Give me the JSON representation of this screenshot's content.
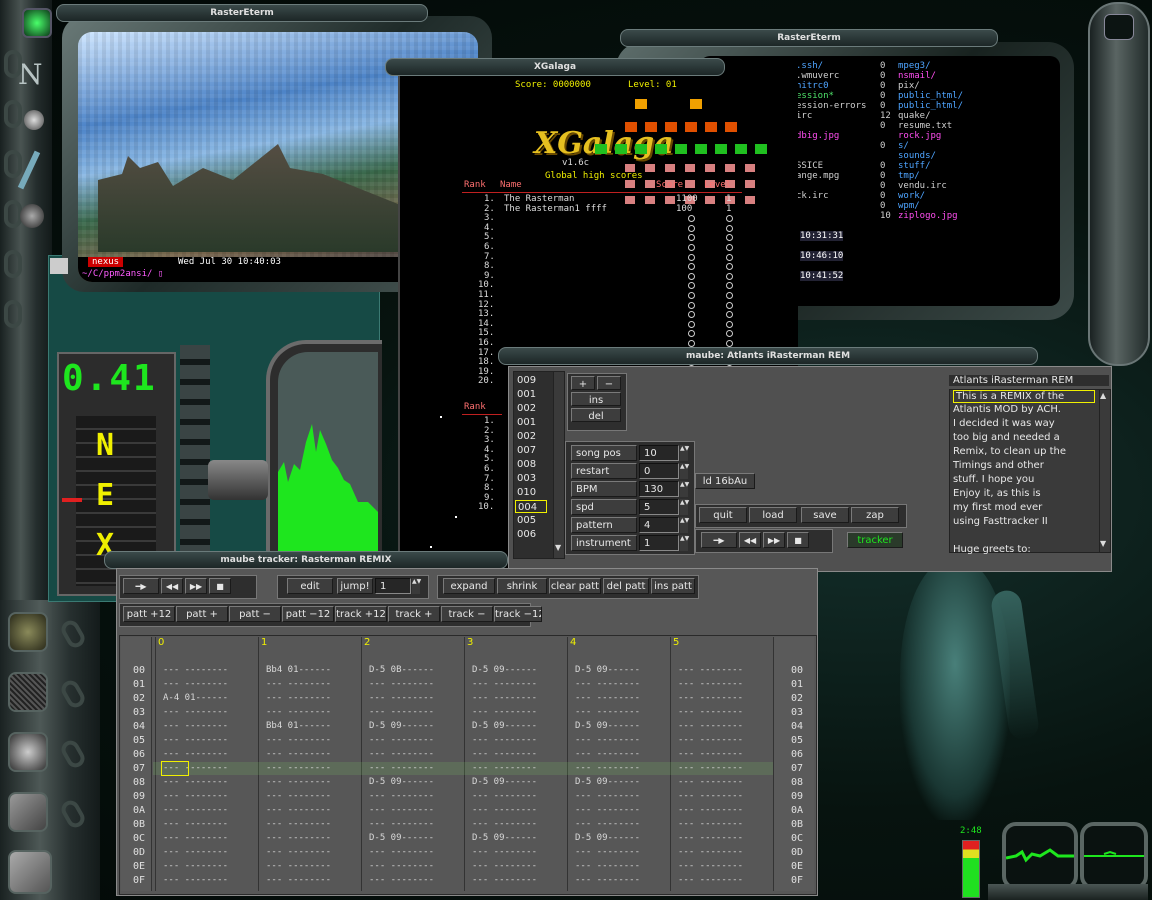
{
  "desktop": {
    "dock_letter": "N"
  },
  "term1": {
    "title": "RasterEterm",
    "status_name": "nexus",
    "status_date": "Wed Jul 30  10:40:03",
    "prompt": "~/C/ppm2ansi/ ▯"
  },
  "term2": {
    "title": "RasterEterm",
    "col1": [
      ".ssh/",
      ".wmuverc",
      "hitrc0",
      "ession*",
      "ession-errors",
      "irc",
      "",
      "dbig.jpg",
      "",
      "",
      "SSICE",
      "ange.mpg",
      "",
      "ck.irc"
    ],
    "col1_colors": [
      "#4ea4ff",
      "#d0d0d0",
      "#4ea4ff",
      "#4ee06a",
      "#d0d0d0",
      "#d0d0d0",
      "#d0d0d0",
      "#ff4ef0",
      "#d0d0d0",
      "#d0d0d0",
      "#d0d0d0",
      "#d0d0d0",
      "#d0d0d0",
      "#d0d0d0"
    ],
    "col2_nums": [
      "0",
      "0",
      "0",
      "0",
      "0",
      "12",
      "0",
      "",
      "0",
      "",
      "0",
      "0",
      "0",
      "0",
      "0",
      "10"
    ],
    "col2": [
      "mpeg3/",
      "nsmail/",
      "pix/",
      "public_html/",
      "public_html/",
      "quake/",
      "resume.txt",
      "rock.jpg",
      "s/",
      "sounds/",
      "stuff/",
      "tmp/",
      "vendu.irc",
      "work/",
      "wpm/",
      "ziplogo.jpg"
    ],
    "col2_colors": [
      "#4ea4ff",
      "#ff4ef0",
      "#d0d0d0",
      "#4ea4ff",
      "#4ea4ff",
      "#d0d0d0",
      "#d0d0d0",
      "#ff4ef0",
      "#4ea4ff",
      "#4ea4ff",
      "#4ea4ff",
      "#4ea4ff",
      "#d0d0d0",
      "#4ea4ff",
      "#4ea4ff",
      "#ff4ef0"
    ],
    "times": [
      "10:31:31",
      "10:46:10",
      "10:41:52"
    ]
  },
  "xgalaga": {
    "title": "XGalaga",
    "score_label": "Score: 0000000",
    "level_label": "Level: 01",
    "logo": "XGalaga",
    "version": "v1.6c",
    "global_label": "Global high scores",
    "rank_label": "Rank",
    "name_label": "Name",
    "score_col_label": "Score",
    "level_col_label": "Level",
    "entries": [
      {
        "rank": "1.",
        "name": "The Rasterman",
        "score": "1100",
        "level": "1"
      },
      {
        "rank": "2.",
        "name": "The Rasterman1 ffff",
        "score": "100",
        "level": "1"
      }
    ],
    "empty_ranks": [
      "3.",
      "4.",
      "5.",
      "6.",
      "7.",
      "8.",
      "9.",
      "10.",
      "11.",
      "12.",
      "13.",
      "14.",
      "15.",
      "16.",
      "17.",
      "18.",
      "19.",
      "20."
    ],
    "rank_label_2": "Rank",
    "ranks2": [
      "1.",
      "2.",
      "3.",
      "4.",
      "5.",
      "6.",
      "7.",
      "8.",
      "9.",
      "10."
    ]
  },
  "maube_main": {
    "title": "maube: Atlants iRasterman REM",
    "pattern_order": [
      "009",
      "001",
      "002",
      "001",
      "002",
      "007",
      "008",
      "003",
      "010",
      "004",
      "005",
      "006"
    ],
    "plus": "+",
    "minus": "−",
    "ins": "ins",
    "del": "del",
    "params": [
      {
        "label": "song pos",
        "value": "10"
      },
      {
        "label": "restart",
        "value": "0"
      },
      {
        "label": "BPM",
        "value": "130"
      },
      {
        "label": "spd",
        "value": "5"
      },
      {
        "label": "pattern",
        "value": "4"
      },
      {
        "label": "instrument",
        "value": "1"
      }
    ],
    "ld_label": "ld 16bAu",
    "quit": "quit",
    "load": "load",
    "save": "save",
    "zap": "zap",
    "tracker": "tracker",
    "song_title": "Atlants iRasterman REM",
    "info_lines": [
      "This is a REMIX of the",
      "Atlantis MOD by ACH.",
      "I decided it was way",
      "too big and needed a",
      "Remix, to clean up the",
      "Timings and other",
      "stuff. I hope you",
      "Enjoy it, as this is",
      "my first mod ever",
      "using Fasttracker II",
      "",
      "Huge greets to:"
    ]
  },
  "tracker": {
    "title": "maube tracker: Rasterman REMIX",
    "edit": "edit",
    "jump": "jump!",
    "jump_value": "1",
    "expand": "expand",
    "shrink": "shrink",
    "clear_patt": "clear patt",
    "del_patt": "del patt",
    "ins_patt": "ins patt",
    "row2": [
      "patt +12",
      "patt +",
      "patt −",
      "patt −12",
      "track +12",
      "track +",
      "track −",
      "track −12"
    ],
    "channels": [
      "0",
      "1",
      "2",
      "3",
      "4",
      "5"
    ],
    "rows": [
      "00",
      "01",
      "02",
      "03",
      "04",
      "05",
      "06",
      "07",
      "08",
      "09",
      "0A",
      "0B",
      "0C",
      "0D",
      "0E",
      "0F"
    ],
    "notes": [
      [
        "--- --------",
        "Bb4 01------",
        "D-5 0B------",
        "D-5 09------",
        "D-5 09------",
        "--- --------"
      ],
      [
        "--- --------",
        "--- --------",
        "--- --------",
        "--- --------",
        "--- --------",
        "--- --------"
      ],
      [
        "A-4 01------",
        "--- --------",
        "--- --------",
        "--- --------",
        "--- --------",
        "--- --------"
      ],
      [
        "--- --------",
        "--- --------",
        "--- --------",
        "--- --------",
        "--- --------",
        "--- --------"
      ],
      [
        "--- --------",
        "Bb4 01------",
        "D-5 09------",
        "D-5 09------",
        "D-5 09------",
        "--- --------"
      ],
      [
        "--- --------",
        "--- --------",
        "--- --------",
        "--- --------",
        "--- --------",
        "--- --------"
      ],
      [
        "--- --------",
        "--- --------",
        "--- --------",
        "--- --------",
        "--- --------",
        "--- --------"
      ],
      [
        "--- --------",
        "--- --------",
        "--- --------",
        "--- --------",
        "--- --------",
        "--- --------"
      ],
      [
        "--- --------",
        "--- --------",
        "D-5 09------",
        "D-5 09------",
        "D-5 09------",
        "--- --------"
      ],
      [
        "--- --------",
        "--- --------",
        "--- --------",
        "--- --------",
        "--- --------",
        "--- --------"
      ],
      [
        "--- --------",
        "--- --------",
        "--- --------",
        "--- --------",
        "--- --------",
        "--- --------"
      ],
      [
        "--- --------",
        "--- --------",
        "--- --------",
        "--- --------",
        "--- --------",
        "--- --------"
      ],
      [
        "--- --------",
        "--- --------",
        "D-5 09------",
        "D-5 09------",
        "D-5 09------",
        "--- --------"
      ],
      [
        "--- --------",
        "--- --------",
        "--- --------",
        "--- --------",
        "--- --------",
        "--- --------"
      ],
      [
        "--- --------",
        "--- --------",
        "--- --------",
        "--- --------",
        "--- --------",
        "--- --------"
      ],
      [
        "--- --------",
        "--- --------",
        "--- --------",
        "--- --------",
        "--- --------",
        "--- --------"
      ]
    ]
  },
  "lcd": {
    "big": "0.41",
    "vertical": [
      "N",
      "E",
      "X"
    ]
  },
  "monitor": {
    "clock": "2:48"
  },
  "colors": {
    "accent_green": "#1ee61e",
    "lcd_yellow": "#f0f000",
    "titlebar_text": "#e0e0e0",
    "tracker_bg": "#575757"
  }
}
